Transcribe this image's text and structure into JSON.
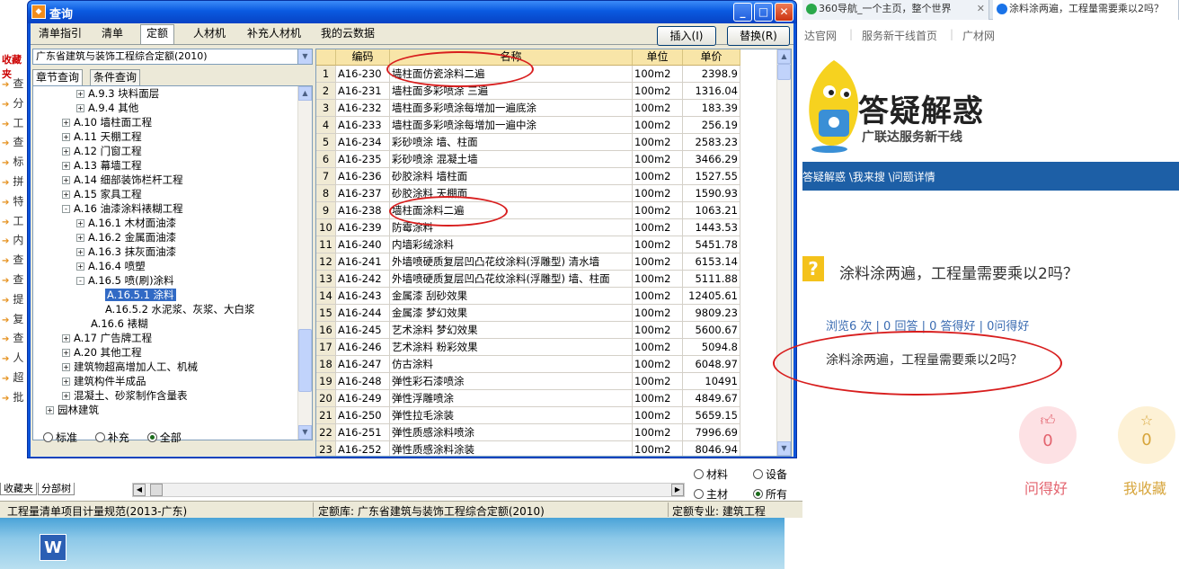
{
  "dialog": {
    "title": "查询",
    "tabs": [
      "清单指引",
      "清单",
      "定额",
      "人材机",
      "补充人材机",
      "我的云数据"
    ],
    "active_tab": "定额",
    "insert_label": "插入(I)",
    "replace_label": "替换(R)"
  },
  "left": {
    "library": "广东省建筑与装饰工程综合定额(2010)",
    "subtabs": [
      "章节查询",
      "条件查询"
    ],
    "tree": [
      {
        "label": "A.9.3 块料面层",
        "pm": "+"
      },
      {
        "label": "A.9.4 其他",
        "pm": "+"
      },
      {
        "label": "A.10 墙柱面工程",
        "pm": "+"
      },
      {
        "label": "A.11 天棚工程",
        "pm": "+"
      },
      {
        "label": "A.12 门窗工程",
        "pm": "+"
      },
      {
        "label": "A.13 幕墙工程",
        "pm": "+"
      },
      {
        "label": "A.14 细部装饰栏杆工程",
        "pm": "+"
      },
      {
        "label": "A.15 家具工程",
        "pm": "+"
      },
      {
        "label": "A.16 油漆涂料裱糊工程",
        "pm": "-"
      },
      {
        "label": "A.16.1 木材面油漆",
        "pm": "+"
      },
      {
        "label": "A.16.2 金属面油漆",
        "pm": "+"
      },
      {
        "label": "A.16.3 抹灰面油漆",
        "pm": "+"
      },
      {
        "label": "A.16.4 喷塑",
        "pm": "+"
      },
      {
        "label": "A.16.5 喷(刷)涂料",
        "pm": "-"
      },
      {
        "label": "A.16.5.1 涂料",
        "pm": ""
      },
      {
        "label": "A.16.5.2 水泥浆、灰浆、大白浆",
        "pm": ""
      },
      {
        "label": "A.16.6 裱糊",
        "pm": ""
      },
      {
        "label": "A.17 广告牌工程",
        "pm": "+"
      },
      {
        "label": "A.20 其他工程",
        "pm": "+"
      },
      {
        "label": "建筑物超高增加人工、机械",
        "pm": "+"
      },
      {
        "label": "建筑构件半成品",
        "pm": "+"
      },
      {
        "label": "混凝土、砂浆制作含量表",
        "pm": "+"
      },
      {
        "label": "园林建筑",
        "pm": "+"
      }
    ],
    "radios": [
      "标准",
      "补充",
      "全部"
    ],
    "selected_radio": "全部"
  },
  "grid": {
    "headers": [
      "编码",
      "名称",
      "单位",
      "单价"
    ],
    "rows": [
      [
        "1",
        "A16-230",
        "墙柱面仿瓷涂料二遍",
        "100m2",
        "2398.9"
      ],
      [
        "2",
        "A16-231",
        "墙柱面多彩喷涂 三遍",
        "100m2",
        "1316.04"
      ],
      [
        "3",
        "A16-232",
        "墙柱面多彩喷涂每增加一遍底涂",
        "100m2",
        "183.39"
      ],
      [
        "4",
        "A16-233",
        "墙柱面多彩喷涂每增加一遍中涂",
        "100m2",
        "256.19"
      ],
      [
        "5",
        "A16-234",
        "彩砂喷涂 墙、柱面",
        "100m2",
        "2583.23"
      ],
      [
        "6",
        "A16-235",
        "彩砂喷涂 混凝土墙",
        "100m2",
        "3466.29"
      ],
      [
        "7",
        "A16-236",
        "砂胶涂料 墙柱面",
        "100m2",
        "1527.55"
      ],
      [
        "8",
        "A16-237",
        "砂胶涂料 天棚面",
        "100m2",
        "1590.93"
      ],
      [
        "9",
        "A16-238",
        "墙柱面涂料二遍",
        "100m2",
        "1063.21"
      ],
      [
        "10",
        "A16-239",
        "防霉涂料",
        "100m2",
        "1443.53"
      ],
      [
        "11",
        "A16-240",
        "内墙彩绒涂料",
        "100m2",
        "5451.78"
      ],
      [
        "12",
        "A16-241",
        "外墙喷硬质复层凹凸花纹涂料(浮雕型) 清水墙",
        "100m2",
        "6153.14"
      ],
      [
        "13",
        "A16-242",
        "外墙喷硬质复层凹凸花纹涂料(浮雕型) 墙、柱面",
        "100m2",
        "5111.88"
      ],
      [
        "14",
        "A16-243",
        "金属漆 刮砂效果",
        "100m2",
        "12405.61"
      ],
      [
        "15",
        "A16-244",
        "金属漆 梦幻效果",
        "100m2",
        "9809.23"
      ],
      [
        "16",
        "A16-245",
        "艺术涂料 梦幻效果",
        "100m2",
        "5600.67"
      ],
      [
        "17",
        "A16-246",
        "艺术涂料 粉彩效果",
        "100m2",
        "5094.8"
      ],
      [
        "18",
        "A16-247",
        "仿古涂料",
        "100m2",
        "6048.97"
      ],
      [
        "19",
        "A16-248",
        "弹性彩石漆喷涂",
        "100m2",
        "10491"
      ],
      [
        "20",
        "A16-249",
        "弹性浮雕喷涂",
        "100m2",
        "4849.67"
      ],
      [
        "21",
        "A16-250",
        "弹性拉毛涂装",
        "100m2",
        "5659.15"
      ],
      [
        "22",
        "A16-251",
        "弹性质感涂料喷涂",
        "100m2",
        "7996.69"
      ],
      [
        "23",
        "A16-252",
        "弹性质感涂料涂装",
        "100m2",
        "8046.94"
      ]
    ]
  },
  "under": {
    "radio_options": [
      "材料",
      "设备",
      "主材",
      "所有"
    ],
    "selected": "所有",
    "bottom_tabs": [
      "收藏夹",
      "分部树"
    ],
    "status_left": "工程量清单项目计量规范(2013-广东)",
    "status_mid": "定额库: 广东省建筑与装饰工程综合定额(2010)",
    "status_right": "定额专业: 建筑工程",
    "side_items": [
      "查",
      "分",
      "工",
      "查",
      "标",
      "拼",
      "特",
      "工",
      "内",
      "查",
      "查",
      "提",
      "复",
      "查",
      "人",
      "超",
      "批"
    ],
    "side_header": "收藏夹"
  },
  "browser": {
    "tab1": "360导航_一个主页，整个世界",
    "tab2": "涂料涂两遍，工程量需要乘以2吗？",
    "nav": [
      "达官网",
      "服务新干线首页",
      "广材网"
    ],
    "banner_title": "答疑解惑",
    "banner_sub": "广联达服务新干线",
    "breadcrumb": "答疑解惑 \\我来搜 \\问题详情",
    "question_title": "涂料涂两遍，工程量需要乘以2吗？",
    "stats": "浏览6 次 | 0 回答 | 0 答得好 | 0问得好",
    "body": "涂料涂两遍，工程量需要乘以2吗？",
    "like_count": "0",
    "fav_count": "0",
    "like_label": "问得好",
    "fav_label": "我收藏"
  },
  "colors": {
    "title_bar": "#0a5ae0",
    "selection": "#316ac5",
    "annotation": "#d81e1e",
    "header_bg": "#f8e5a8"
  }
}
